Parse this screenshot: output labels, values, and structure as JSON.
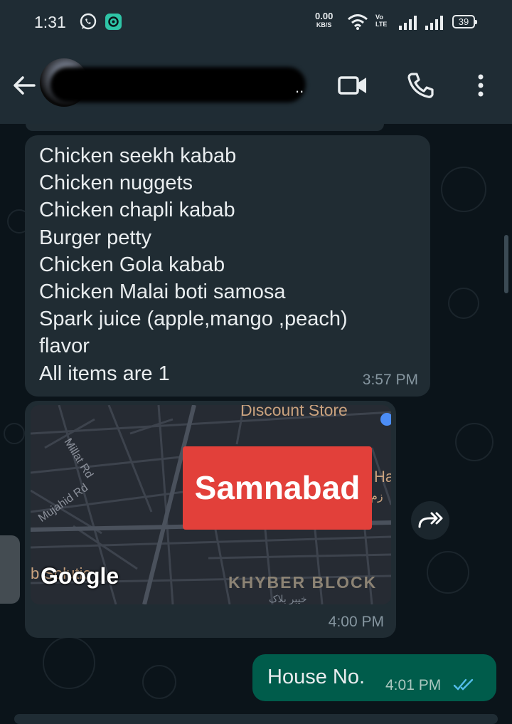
{
  "status_bar": {
    "time": "1:31",
    "net_speed_value": "0.00",
    "net_speed_unit": "KB/S",
    "volte_top": "Vo",
    "volte_bottom": "LTE",
    "battery": "39"
  },
  "header": {
    "contact_name_suffix": ".."
  },
  "messages": [
    {
      "lines": [
        "Chicken seekh kabab",
        "Chicken nuggets",
        "Chicken chapli kabab",
        "Burger petty",
        "Chicken Gola kabab",
        "Chicken Malai boti samosa",
        "Spark juice (apple,mango ,peach)",
        "flavor",
        "All items are 1"
      ],
      "time": "3:57 PM"
    },
    {
      "map": {
        "location_label": "Samnabad",
        "provider": "Google",
        "labels": {
          "store": "Discount Store",
          "road1": "Millat Rd",
          "road2": "Mujahid Rd",
          "block": "KHYBER BLOCK",
          "partial_right": "i Ha",
          "partial_urdu": "زم",
          "partial_left": "b Solutio",
          "partial_urdu_bottom": "خیبر بلاک"
        }
      },
      "time": "4:00 PM"
    },
    {
      "text": "House No.",
      "time": "4:01 PM",
      "status": "read"
    }
  ],
  "colors": {
    "app_bar": "#1f2c34",
    "background": "#0b141a",
    "incoming_bubble": "#202c33",
    "outgoing_bubble": "#005c4b",
    "read_tick": "#53bdeb",
    "map_highlight": "#e2403a"
  }
}
